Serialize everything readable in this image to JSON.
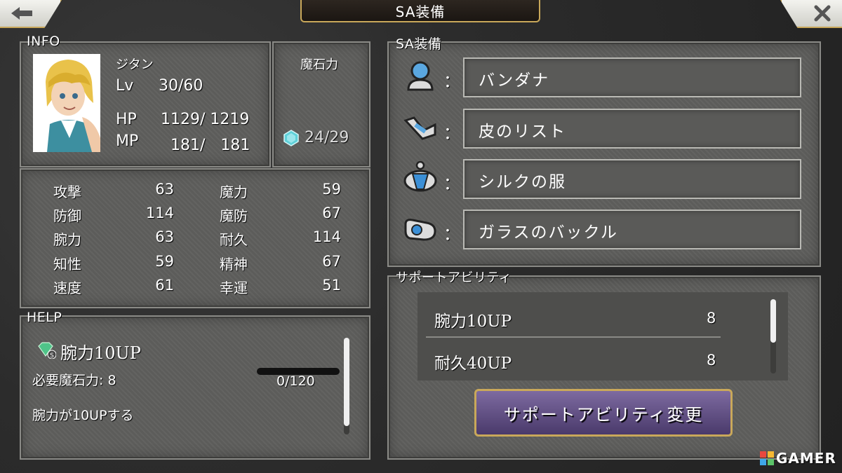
{
  "header": {
    "title": "SA装備",
    "back_icon": "back-arrow-icon",
    "close_icon": "close-icon"
  },
  "info": {
    "label": "INFO",
    "name": "ジタン",
    "lv_label": "Lv",
    "lv": "30/60",
    "hp_label": "HP",
    "hp": "1129/ 1219",
    "mp_label": "MP",
    "mp": "181/　181",
    "magicite_label": "魔石力",
    "magicite_value": "24/29"
  },
  "stats": [
    {
      "label": "攻撃",
      "value": "63"
    },
    {
      "label": "魔力",
      "value": "59"
    },
    {
      "label": "防御",
      "value": "114"
    },
    {
      "label": "魔防",
      "value": "67"
    },
    {
      "label": "腕力",
      "value": "63"
    },
    {
      "label": "耐久",
      "value": "114"
    },
    {
      "label": "知性",
      "value": "59"
    },
    {
      "label": "精神",
      "value": "67"
    },
    {
      "label": "速度",
      "value": "61"
    },
    {
      "label": "幸運",
      "value": "51"
    }
  ],
  "help": {
    "label": "HELP",
    "ability_name": "腕力10UP",
    "required_label": "必要魔石力: 8",
    "progress_text": "0/120",
    "progress": 0,
    "description": "腕力が10UPする"
  },
  "sa_equip": {
    "label": "SA装備",
    "slots": [
      {
        "icon": "head-slot-icon",
        "name": "バンダナ"
      },
      {
        "icon": "arm-slot-icon",
        "name": "皮のリスト"
      },
      {
        "icon": "body-slot-icon",
        "name": "シルクの服"
      },
      {
        "icon": "accessory-slot-icon",
        "name": "ガラスのバックル"
      }
    ],
    "colon": "："
  },
  "support": {
    "label": "サポートアビリティ",
    "abilities": [
      {
        "name": "腕力10UP",
        "cost": "8"
      },
      {
        "name": "耐久40UP",
        "cost": "8"
      }
    ],
    "change_button": "サポートアビリティ変更"
  },
  "watermark": "GAMER",
  "colors": {
    "accent_gold": "#c9a85a",
    "panel": "#5f5f5d",
    "button_purple": "#5e4a82"
  }
}
